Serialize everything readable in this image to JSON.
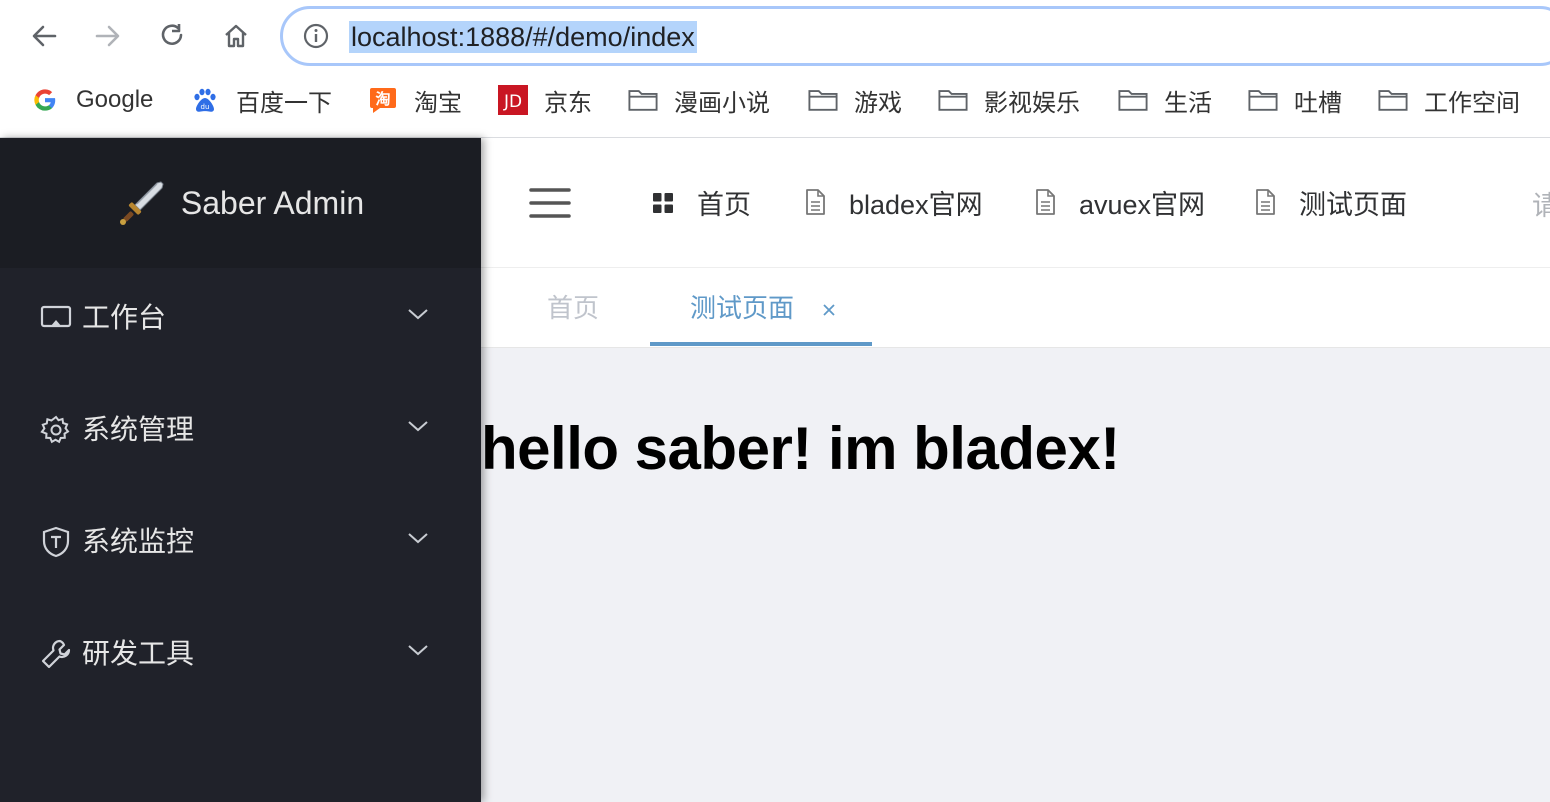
{
  "browser": {
    "url": "localhost:1888/#/demo/index",
    "bookmarks": [
      {
        "label": "Google",
        "icon": "google-icon"
      },
      {
        "label": "百度一下",
        "icon": "baidu-icon"
      },
      {
        "label": "淘宝",
        "icon": "taobao-icon"
      },
      {
        "label": "京东",
        "icon": "jd-icon"
      },
      {
        "label": "漫画小说",
        "icon": "folder-icon"
      },
      {
        "label": "游戏",
        "icon": "folder-icon"
      },
      {
        "label": "影视娱乐",
        "icon": "folder-icon"
      },
      {
        "label": "生活",
        "icon": "folder-icon"
      },
      {
        "label": "吐槽",
        "icon": "folder-icon"
      },
      {
        "label": "工作空间",
        "icon": "folder-icon"
      }
    ],
    "jd_logo_text": "JD",
    "taobao_logo_text": "淘"
  },
  "sidebar": {
    "app_name": "Saber Admin",
    "items": [
      {
        "label": "工作台",
        "icon": "monitor-icon"
      },
      {
        "label": "系统管理",
        "icon": "gear-icon"
      },
      {
        "label": "系统监控",
        "icon": "shield-icon"
      },
      {
        "label": "研发工具",
        "icon": "wrench-icon"
      }
    ]
  },
  "topbar": {
    "nav": [
      {
        "label": "首页",
        "icon": "grid-icon"
      },
      {
        "label": "bladex官网",
        "icon": "document-icon"
      },
      {
        "label": "avuex官网",
        "icon": "document-icon"
      },
      {
        "label": "测试页面",
        "icon": "document-icon"
      }
    ],
    "search_hint": "请"
  },
  "tags": [
    {
      "label": "首页",
      "active": false
    },
    {
      "label": "测试页面",
      "active": true
    }
  ],
  "content": {
    "heading": "hello saber! im bladex!"
  },
  "colors": {
    "sidebar_bg": "#20222a",
    "accent": "#5f99c8",
    "content_bg": "#f0f1f5",
    "url_highlight": "#b4d4fb"
  }
}
